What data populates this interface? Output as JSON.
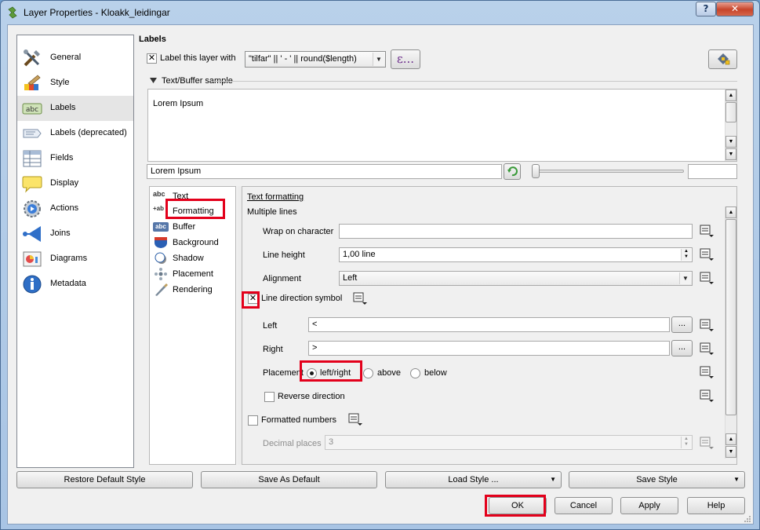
{
  "window": {
    "title": "Layer Properties - Kloakk_leidingar",
    "help_label": "?",
    "close_label": "✕"
  },
  "nav": {
    "items": [
      {
        "label": "General",
        "icon": "tools-icon"
      },
      {
        "label": "Style",
        "icon": "paintbrush-icon"
      },
      {
        "label": "Labels",
        "icon": "abc-label-icon"
      },
      {
        "label": "Labels (deprecated)",
        "icon": "label-deprecated-icon"
      },
      {
        "label": "Fields",
        "icon": "table-icon"
      },
      {
        "label": "Display",
        "icon": "speech-bubble-icon"
      },
      {
        "label": "Actions",
        "icon": "gear-play-icon"
      },
      {
        "label": "Joins",
        "icon": "join-arrow-icon"
      },
      {
        "label": "Diagrams",
        "icon": "diagram-icon"
      },
      {
        "label": "Metadata",
        "icon": "info-icon"
      }
    ],
    "selected": "Labels"
  },
  "labels": {
    "section_title": "Labels",
    "label_this_layer": "Label this layer with",
    "label_checked": true,
    "expression": "\"tilfar\"  || ' - ' || round($length)",
    "expression_button": "ε...",
    "sample_header": "Text/Buffer sample",
    "sample_text": "Lorem Ipsum",
    "sample_input": "Lorem Ipsum"
  },
  "subnav": {
    "items": [
      {
        "label": "Text",
        "icon_text": "abc"
      },
      {
        "label": "Formatting",
        "icon_text": "+ab"
      },
      {
        "label": "Buffer",
        "icon_text": "abc"
      },
      {
        "label": "Background",
        "icon_text": ""
      },
      {
        "label": "Shadow",
        "icon_text": ""
      },
      {
        "label": "Placement",
        "icon_text": ""
      },
      {
        "label": "Rendering",
        "icon_text": ""
      }
    ]
  },
  "formatting": {
    "header": "Text formatting",
    "multiple_lines": "Multiple lines",
    "wrap_label": "Wrap on character",
    "wrap_value": "",
    "line_height_label": "Line height",
    "line_height_value": "1,00 line",
    "alignment_label": "Alignment",
    "alignment_value": "Left",
    "line_direction_label": "Line direction symbol",
    "line_direction_checked": true,
    "left_label": "Left",
    "left_value": "<",
    "right_label": "Right",
    "right_value": ">",
    "browse_label": "...",
    "placement_label": "Placement",
    "placement_options": [
      "left/right",
      "above",
      "below"
    ],
    "placement_selected": "left/right",
    "reverse_label": "Reverse direction",
    "formatted_numbers_label": "Formatted numbers",
    "decimal_places_label": "Decimal places",
    "decimal_places_value": "3"
  },
  "buttons": {
    "restore_default": "Restore Default Style",
    "save_as_default": "Save As Default",
    "load_style": "Load Style ...",
    "save_style": "Save Style",
    "ok": "OK",
    "cancel": "Cancel",
    "apply": "Apply",
    "help": "Help"
  },
  "colors": {
    "highlight": "#e3001b",
    "selection": "#e5e5e5"
  }
}
